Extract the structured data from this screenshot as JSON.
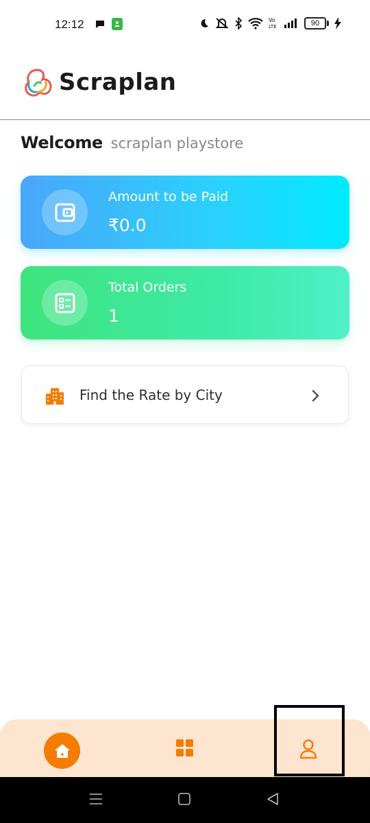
{
  "status_bar": {
    "time": "12:12",
    "battery": "90",
    "icons": [
      "chat-bubble-icon",
      "app-notification-icon",
      "moon-icon",
      "mute-icon",
      "bluetooth-icon",
      "wifi-icon",
      "volte-icon",
      "signal-icon",
      "battery-icon",
      "charging-icon"
    ]
  },
  "header": {
    "app_name": "Scraplan"
  },
  "welcome": {
    "greeting": "Welcome",
    "username": "scraplan playstore"
  },
  "cards": {
    "amount": {
      "label": "Amount to be Paid",
      "value": "₹0.0",
      "icon": "wallet-icon"
    },
    "orders": {
      "label": "Total Orders",
      "value": "1",
      "icon": "orders-list-icon"
    }
  },
  "find_rate": {
    "label": "Find the Rate by City",
    "icon": "city-building-icon"
  },
  "bottom_nav": {
    "items": [
      "home-icon",
      "dashboard-grid-icon",
      "profile-icon"
    ]
  },
  "colors": {
    "accent": "#f57c00",
    "nav_background": "#fde5d0",
    "card_blue": "#2ad2fb",
    "card_green": "#3eeaa6"
  }
}
